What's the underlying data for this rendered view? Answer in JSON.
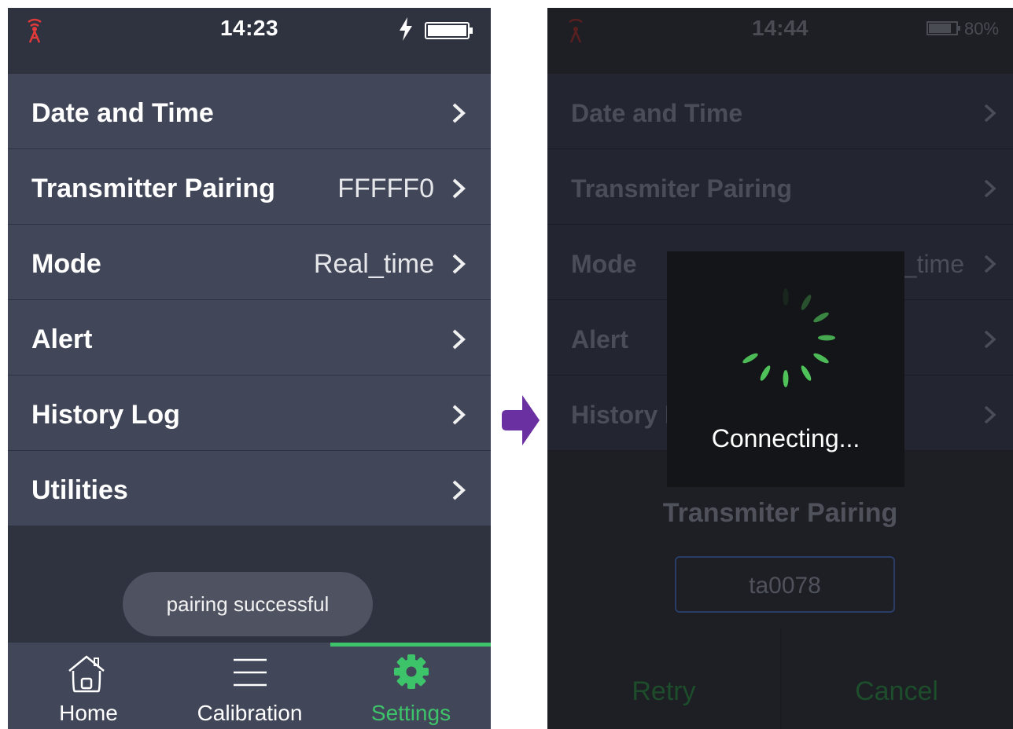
{
  "left_screen": {
    "status": {
      "time": "14:23",
      "signal_icon": "antenna-icon",
      "charging_icon": "lightning-bolt-icon",
      "battery_icon": "battery-full-icon"
    },
    "menu": [
      {
        "label": "Date and Time",
        "value": ""
      },
      {
        "label": "Transmitter Pairing",
        "value": "FFFFF0"
      },
      {
        "label": "Mode",
        "value": "Real_time"
      },
      {
        "label": "Alert",
        "value": ""
      },
      {
        "label": "History Log",
        "value": ""
      },
      {
        "label": "Utilities",
        "value": ""
      }
    ],
    "toast": "pairing successful",
    "nav": [
      {
        "label": "Home",
        "icon": "house-icon"
      },
      {
        "label": "Calibration",
        "icon": "list-icon"
      },
      {
        "label": "Settings",
        "icon": "gear-icon",
        "active": true
      }
    ],
    "colors": {
      "background": "#2f3340",
      "row": "#414658",
      "active": "#3dc46a"
    }
  },
  "right_screen": {
    "status": {
      "time": "14:44",
      "battery_pct": "80%"
    },
    "menu": [
      {
        "label": "Date and Time",
        "value": ""
      },
      {
        "label": "Transmiter Pairing",
        "value": ""
      },
      {
        "label": "Mode",
        "value": "Real_time"
      },
      {
        "label": "Alert",
        "value": ""
      },
      {
        "label": "History Log",
        "value": ""
      }
    ],
    "loading": {
      "text": "Connecting..."
    },
    "dialog": {
      "title": "Transmiter Pairing",
      "input_value": "ta0078",
      "retry": "Retry",
      "cancel": "Cancel"
    },
    "colors": {
      "background": "#1d1f25",
      "spinner": "#4fc35a",
      "button_text": "#1d4d2a"
    }
  },
  "arrow": {
    "icon": "arrow-right-icon",
    "color": "#6a2fa0"
  }
}
